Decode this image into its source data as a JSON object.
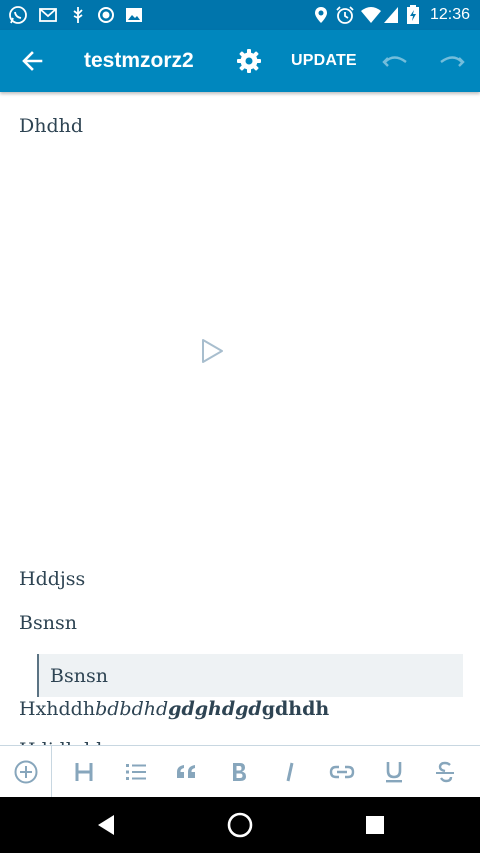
{
  "status_bar": {
    "time": "12:36",
    "icons": [
      "whatsapp-icon",
      "gmail-icon",
      "usb-debug-icon",
      "sync-icon",
      "image-icon",
      "location-icon",
      "alarm-icon",
      "wifi-icon",
      "battery-icon"
    ]
  },
  "app_bar": {
    "title": "testmzorz2",
    "update_label": "UPDATE"
  },
  "editor": {
    "paragraph_1": "Dhdhd",
    "paragraph_2": "Hddjss",
    "paragraph_3": "Bsnsn",
    "quote": "Bsnsn",
    "mixed": {
      "regular": "Hxhddh",
      "italic": "bdbdhd",
      "bold_italic": "gdghdgd",
      "bold": "gdhdh"
    },
    "partial_line": "Hdjdhdd"
  },
  "format_toolbar": {
    "tools": [
      "add-block-icon",
      "heading-icon",
      "list-icon",
      "quote-icon",
      "bold-icon",
      "italic-icon",
      "link-icon",
      "underline-icon",
      "strikethrough-icon"
    ]
  },
  "colors": {
    "status_bar": "#0075ac",
    "app_bar": "#0087be",
    "text": "#2e4453",
    "toolbar_icon": "#87a6bc",
    "quote_bg": "#eef2f4"
  }
}
